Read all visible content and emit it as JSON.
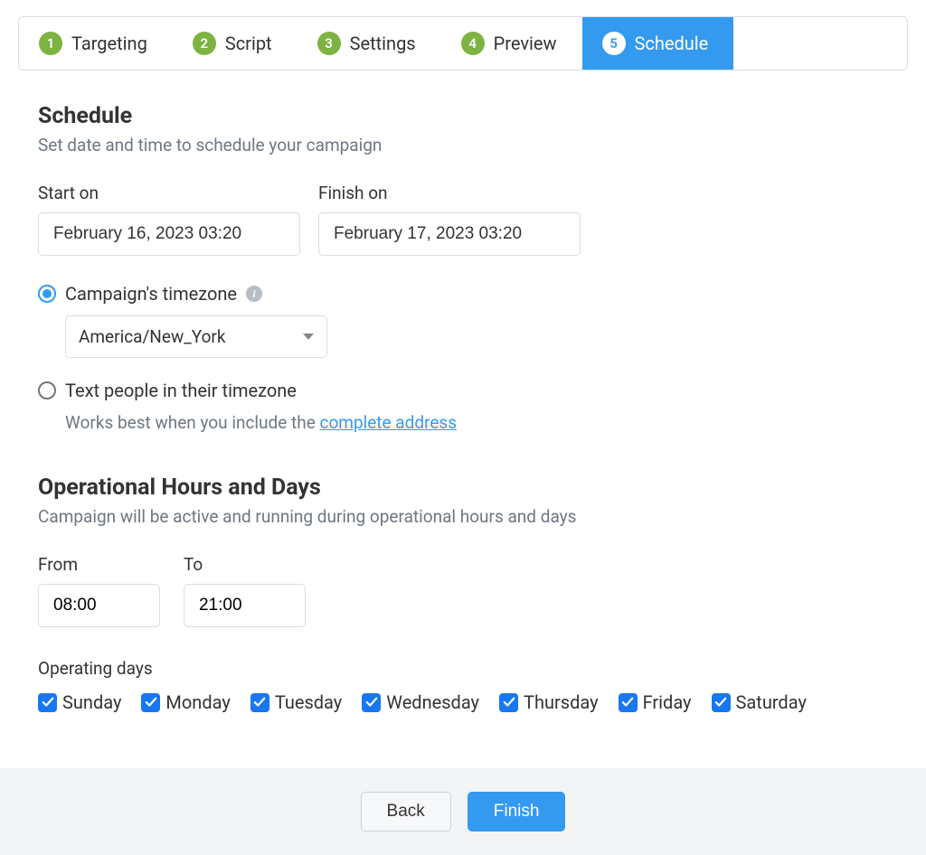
{
  "wizard": {
    "steps": [
      {
        "num": "1",
        "label": "Targeting"
      },
      {
        "num": "2",
        "label": "Script"
      },
      {
        "num": "3",
        "label": "Settings"
      },
      {
        "num": "4",
        "label": "Preview"
      },
      {
        "num": "5",
        "label": "Schedule"
      }
    ],
    "active_index": 4
  },
  "schedule": {
    "title": "Schedule",
    "subtitle": "Set date and time to schedule your campaign",
    "start_label": "Start on",
    "start_value": "February 16, 2023 03:20",
    "finish_label": "Finish on",
    "finish_value": "February 17, 2023 03:20"
  },
  "timezone": {
    "option_campaign_label": "Campaign's timezone",
    "selected_value": "America/New_York",
    "option_recipient_label": "Text people in their timezone",
    "recipient_hint_prefix": "Works best when you include the ",
    "recipient_hint_link": "complete address"
  },
  "operational": {
    "title": "Operational Hours and Days",
    "subtitle": "Campaign will be active and running during operational hours and days",
    "from_label": "From",
    "from_value": "08:00",
    "to_label": "To",
    "to_value": "21:00",
    "days_label": "Operating days",
    "days": [
      {
        "label": "Sunday",
        "checked": true
      },
      {
        "label": "Monday",
        "checked": true
      },
      {
        "label": "Tuesday",
        "checked": true
      },
      {
        "label": "Wednesday",
        "checked": true
      },
      {
        "label": "Thursday",
        "checked": true
      },
      {
        "label": "Friday",
        "checked": true
      },
      {
        "label": "Saturday",
        "checked": true
      }
    ]
  },
  "footer": {
    "back_label": "Back",
    "finish_label": "Finish"
  }
}
